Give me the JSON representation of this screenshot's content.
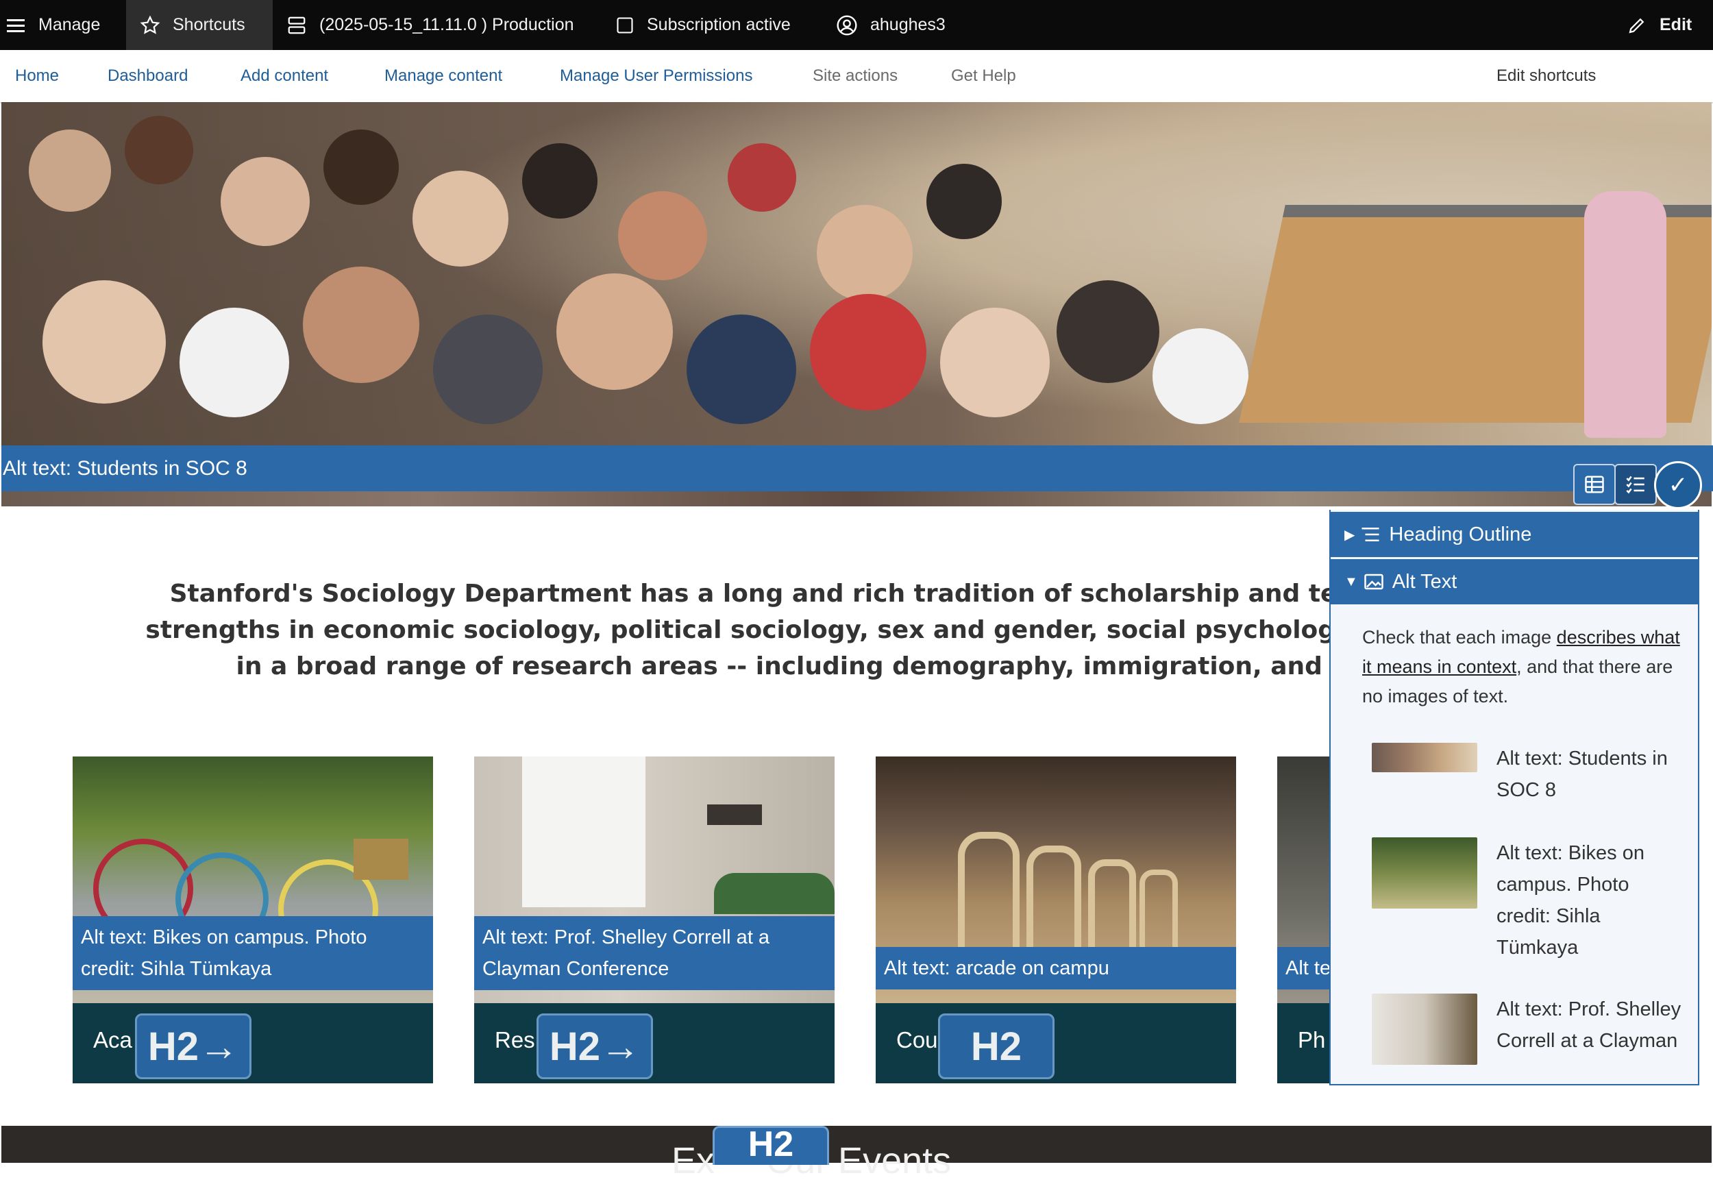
{
  "toolbar": {
    "manage": "Manage",
    "shortcuts": "Shortcuts",
    "environment": "(2025-05-15_11.11.0 ) Production",
    "subscription": "Subscription active",
    "user": "ahughes3",
    "edit": "Edit"
  },
  "shortcuts_tray": {
    "links": [
      "Home",
      "Dashboard",
      "Add content",
      "Manage content",
      "Manage User Permissions",
      "Site actions",
      "Get Help"
    ],
    "edit_shortcuts": "Edit shortcuts"
  },
  "hero": {
    "alt_text": "Alt text: Students in SOC 8"
  },
  "intro": {
    "line1": "Stanford's Sociology Department has a long and rich tradition of scholarship and teaching. In addi",
    "line2": "strengths in  economic sociology, political sociology, sex and gender, social psychology, and inequality",
    "line3": "in a broad range of research areas -- including demography, immigration, and race and e"
  },
  "cards": [
    {
      "alt": "Alt text: Bikes on campus. Photo credit: Sihla Tümkaya",
      "label": "Aca",
      "badge": "H2→"
    },
    {
      "alt": "Alt text: Prof. Shelley Correll at a Clayman Conference",
      "label": "Res",
      "badge": "H2→"
    },
    {
      "alt": "Alt text: arcade on campu",
      "label": "Cou",
      "badge": "H2"
    },
    {
      "alt": "Alt te",
      "label": "Ph",
      "badge": ""
    }
  ],
  "bottom": {
    "heading": "Ex     Our Events",
    "badge": "H2"
  },
  "panel": {
    "heading_outline": "Heading Outline",
    "alt_text": "Alt Text",
    "desc_pre": "Check that each image ",
    "desc_link": "describes what it means in context",
    "desc_post": ", and that there are no images of text.",
    "items": [
      {
        "text": "Alt text: Students in SOC 8"
      },
      {
        "text": "Alt text: Bikes on campus. Photo credit: Sihla Tümkaya"
      },
      {
        "text": "Alt text: Prof. Shelley Correll at a Clayman"
      }
    ]
  },
  "colors": {
    "toolbar_bg": "#0b0b0b",
    "accent_blue": "#2b69a8",
    "card_dark": "#0e3a46",
    "link_blue": "#1f5d99"
  }
}
